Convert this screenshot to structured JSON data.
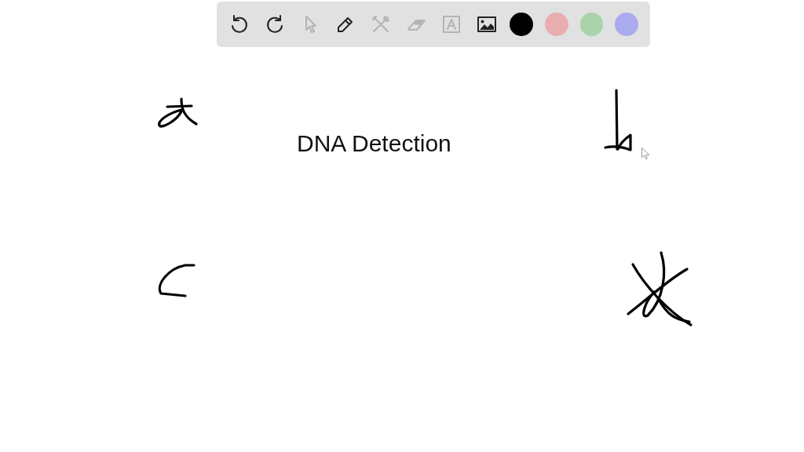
{
  "toolbar": {
    "tools": [
      {
        "kind": "undo",
        "disabled": false
      },
      {
        "kind": "redo",
        "disabled": false
      },
      {
        "kind": "select",
        "disabled": true
      },
      {
        "kind": "pen",
        "disabled": false
      },
      {
        "kind": "tools",
        "disabled": true
      },
      {
        "kind": "eraser",
        "disabled": true
      },
      {
        "kind": "text",
        "disabled": true
      },
      {
        "kind": "image",
        "disabled": false
      }
    ],
    "colors": [
      {
        "color": "#000000"
      },
      {
        "color": "#e8aeae"
      },
      {
        "color": "#a9d3a9"
      },
      {
        "color": "#aaaaee"
      }
    ]
  },
  "canvas": {
    "title": "DNA Detection"
  }
}
